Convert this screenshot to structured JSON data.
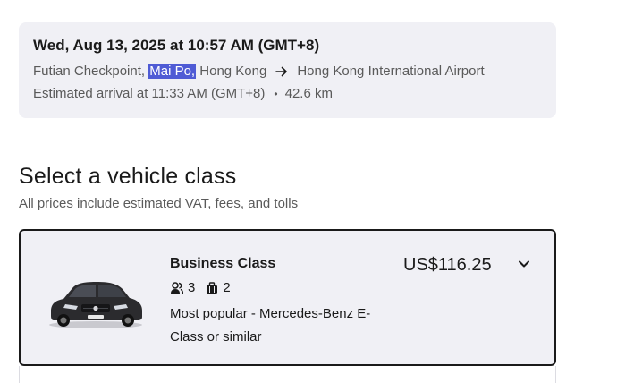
{
  "trip": {
    "datetime": "Wed, Aug 13, 2025 at 10:57 AM (GMT+8)",
    "from_prefix": "Futian Checkpoint, ",
    "from_highlight": "Mai Po,",
    "from_suffix": " Hong Kong",
    "to": "Hong Kong International Airport",
    "arrival": "Estimated arrival at 11:33 AM (GMT+8)",
    "separator": "•",
    "distance": "42.6 km"
  },
  "section": {
    "title": "Select a vehicle class",
    "subtitle": "All prices include estimated VAT, fees, and tolls"
  },
  "vehicles": [
    {
      "class_name": "Business Class",
      "passengers": "3",
      "luggage": "2",
      "description": "Most popular - Mercedes-Benz E-Class or similar",
      "price": "US$116.25"
    }
  ],
  "colors": {
    "card_bg": "#f0f0f5",
    "highlight": "#4f5bd5",
    "text_primary": "#1a1a1a",
    "text_secondary": "#5a5a5a"
  },
  "icons": {
    "route_arrow": "arrow-right-icon",
    "passengers": "person-icon",
    "luggage": "briefcase-icon",
    "expand": "chevron-down-icon"
  }
}
